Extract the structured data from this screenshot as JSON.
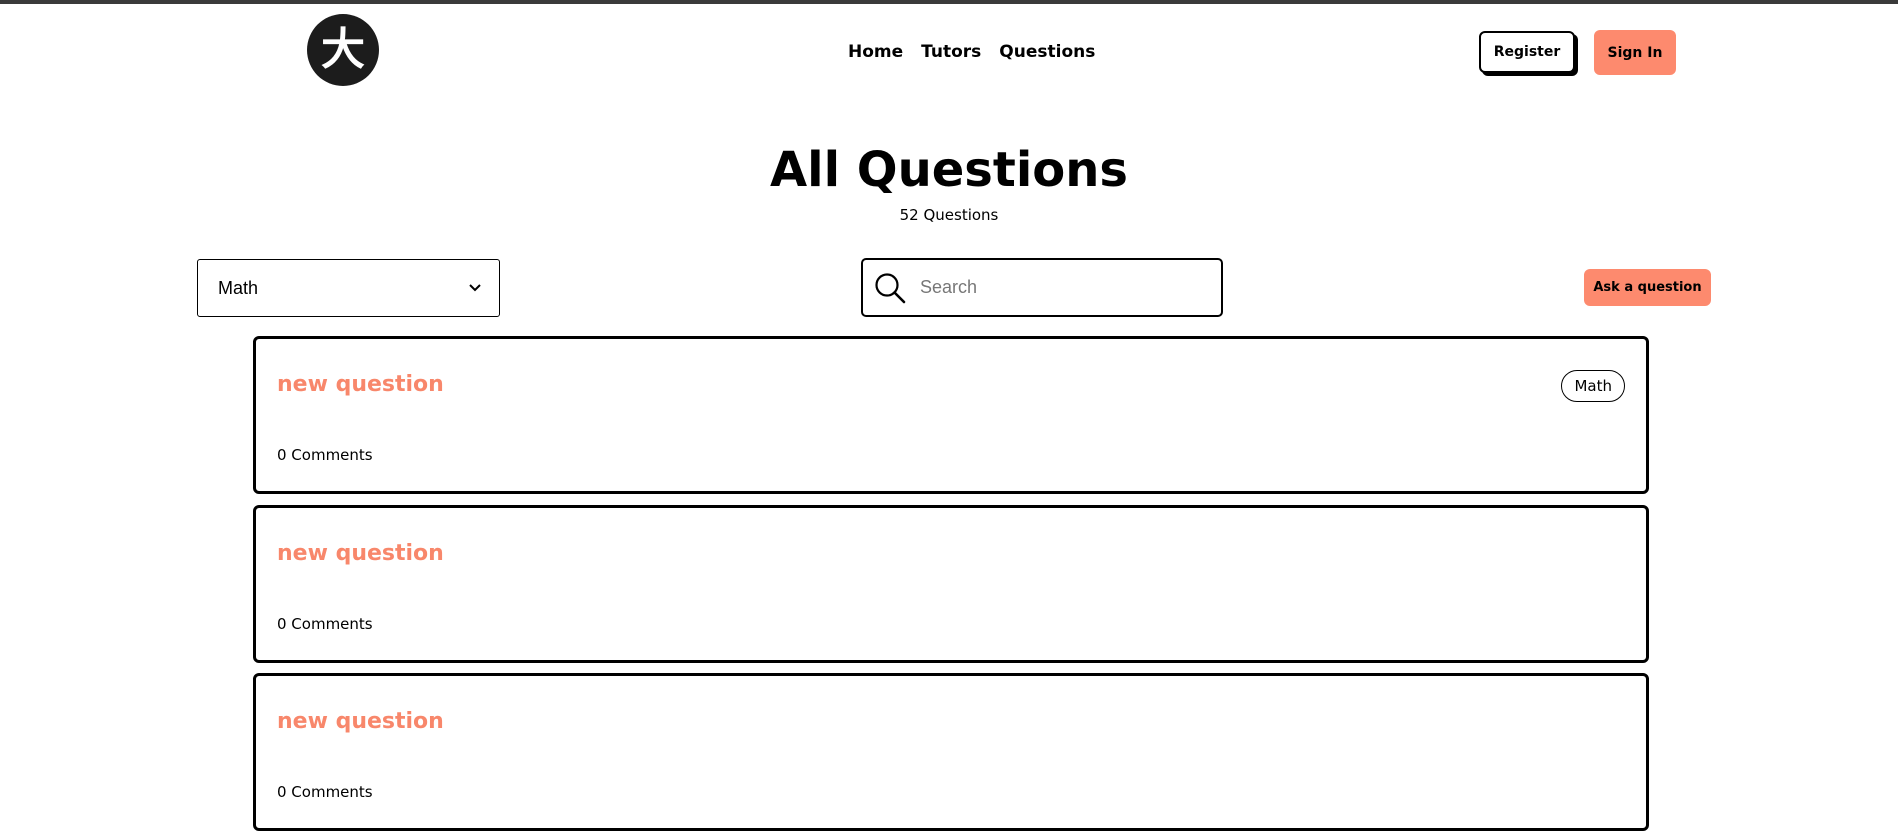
{
  "header": {
    "logo_text": "大",
    "nav": [
      {
        "label": "Home"
      },
      {
        "label": "Tutors"
      },
      {
        "label": "Questions"
      }
    ],
    "register_label": "Register",
    "signin_label": "Sign In"
  },
  "main": {
    "title": "All Questions",
    "subtitle": "52 Questions",
    "filter": {
      "selected": "Math"
    },
    "search": {
      "placeholder": "Search",
      "value": ""
    },
    "ask_label": "Ask a question"
  },
  "questions": [
    {
      "title": "new question",
      "comments": "0 Comments",
      "tag": "Math"
    },
    {
      "title": "new question",
      "comments": "0 Comments",
      "tag": ""
    },
    {
      "title": "new question",
      "comments": "0 Comments",
      "tag": ""
    }
  ],
  "colors": {
    "accent": "#fd8a6e",
    "question_title": "#f8876b",
    "logo_bg": "#1c1c1c",
    "top_line": "#3a3a3a"
  },
  "icons": {
    "search": "search-icon",
    "select_chevron": "chevron-down-icon"
  }
}
